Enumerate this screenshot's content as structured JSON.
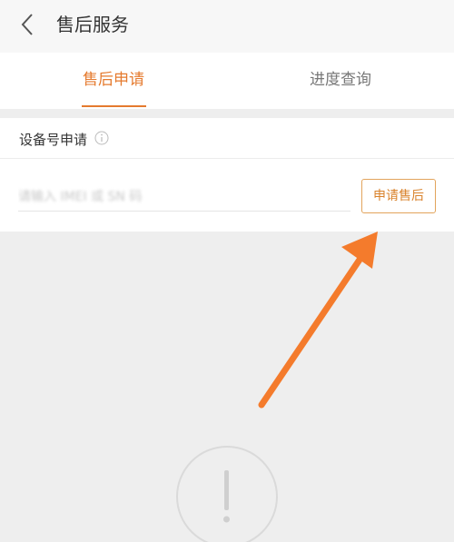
{
  "header": {
    "title": "售后服务",
    "back_icon": "chevron-left-icon"
  },
  "tabs": [
    {
      "label": "售后申请",
      "active": true
    },
    {
      "label": "进度查询",
      "active": false
    }
  ],
  "section": {
    "title": "设备号申请",
    "info_icon": "info-icon"
  },
  "form": {
    "placeholder": "请输入 IMEI 或 SN 码",
    "value": "",
    "submit_label": "申请售后"
  },
  "overlay": {
    "arrow_icon": "annotation-arrow-icon",
    "arrow_color": "#f47b2c"
  },
  "empty_state": {
    "icon": "exclamation-circle-icon"
  },
  "colors": {
    "accent": "#e57a2e",
    "button_border": "#e2a45c",
    "background": "#eeeeee"
  }
}
